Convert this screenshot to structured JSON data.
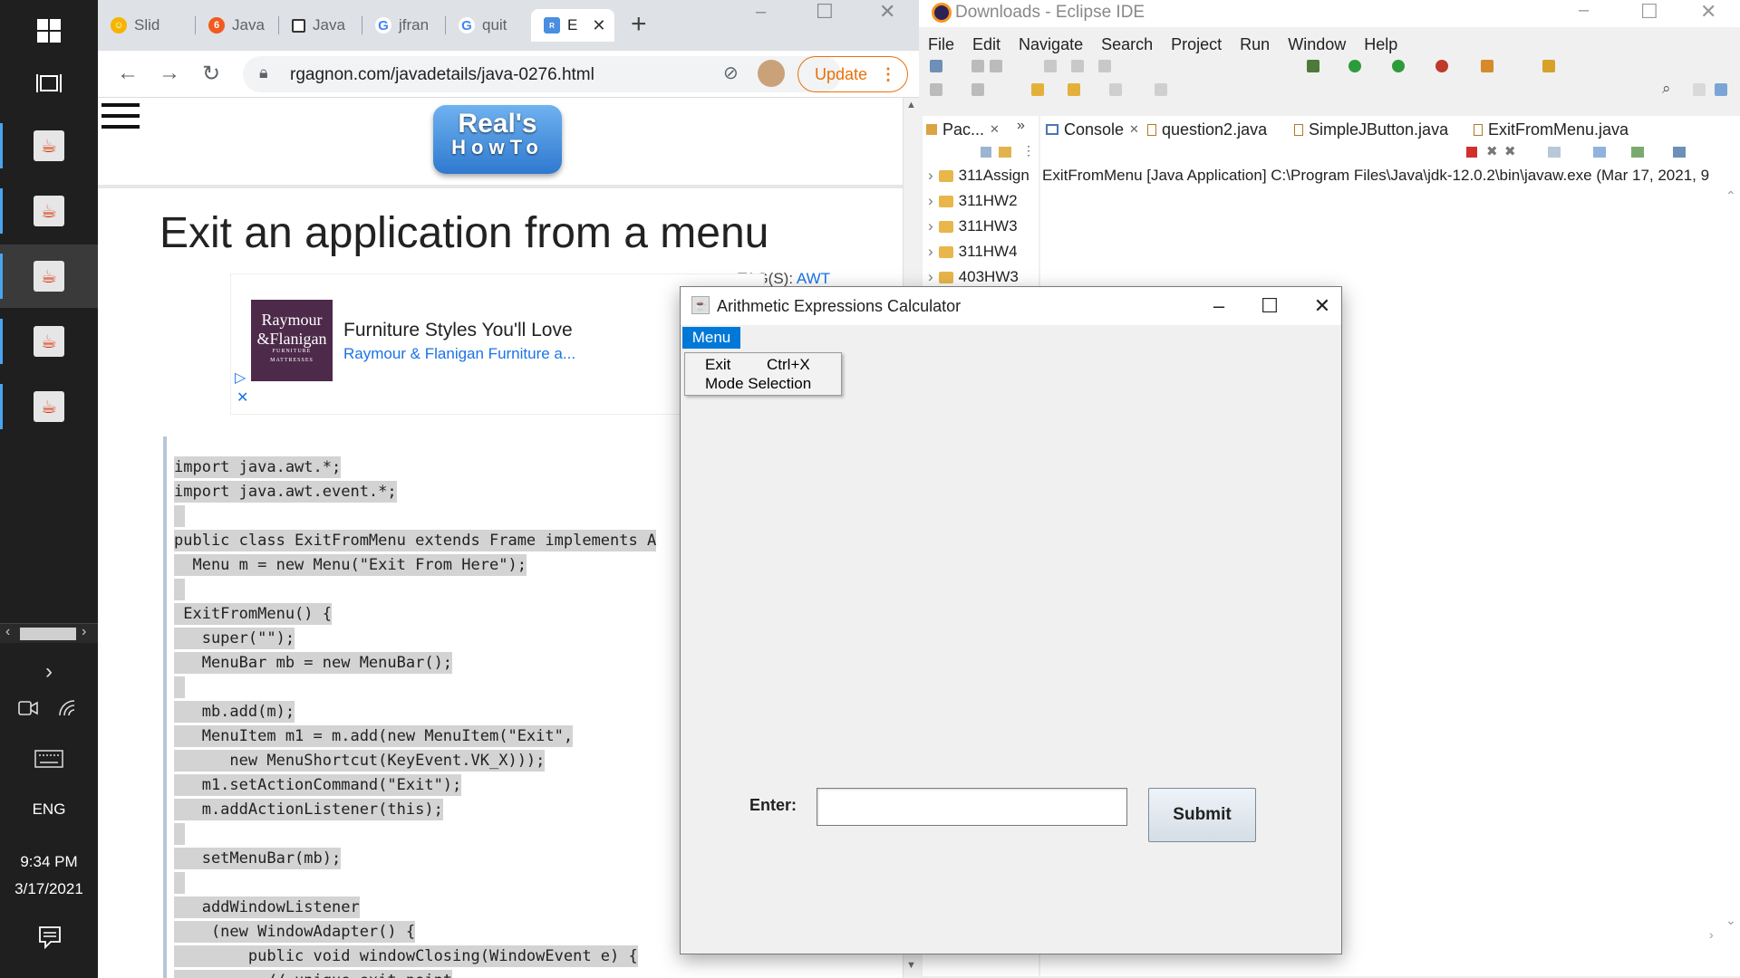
{
  "taskbar": {
    "language": "ENG",
    "time": "9:34 PM",
    "date": "3/17/2021"
  },
  "chrome": {
    "tabs": [
      {
        "label": "Slid",
        "icon": "slides-icon"
      },
      {
        "label": "Java",
        "icon": "orange-site-icon"
      },
      {
        "label": "Java",
        "icon": "square-site-icon"
      },
      {
        "label": "jfran",
        "icon": "google-icon"
      },
      {
        "label": "quit",
        "icon": "google-icon"
      },
      {
        "label": "E",
        "icon": "realshowto-icon",
        "active": true
      }
    ],
    "new_tab_label": "+",
    "url": "rgagnon.com/javadetails/java-0276.html",
    "update_label": "Update",
    "window_controls": [
      "–",
      "☐",
      "✕"
    ]
  },
  "page": {
    "logo_line1": "Real's",
    "logo_line2": "HowTo",
    "title": "Exit an application from a menu",
    "tags_label": "TAG(S):",
    "tags_value": "AWT",
    "ad": {
      "brand_line1": "Raymour",
      "brand_line2": "&Flanigan",
      "brand_line3": "FURNITURE",
      "brand_line4": "MATTRESSES",
      "headline": "Furniture Styles You'll Love",
      "subline": "Raymour & Flanigan Furniture a..."
    },
    "code_lines": [
      "import java.awt.*;",
      "import java.awt.event.*;",
      "",
      "public class ExitFromMenu extends Frame implements A",
      "  Menu m = new Menu(\"Exit From Here\");",
      "",
      " ExitFromMenu() {",
      "   super(\"\");",
      "   MenuBar mb = new MenuBar();",
      "",
      "   mb.add(m);",
      "   MenuItem m1 = m.add(new MenuItem(\"Exit\",",
      "      new MenuShortcut(KeyEvent.VK_X)));",
      "   m1.setActionCommand(\"Exit\");",
      "   m.addActionListener(this);",
      "",
      "   setMenuBar(mb);",
      "",
      "   addWindowListener",
      "    (new WindowAdapter() {",
      "        public void windowClosing(WindowEvent e) {",
      "          // unique exit point"
    ]
  },
  "eclipse": {
    "title": "Downloads - Eclipse IDE",
    "menus": [
      "File",
      "Edit",
      "Navigate",
      "Search",
      "Project",
      "Run",
      "Window",
      "Help"
    ],
    "package_tab": "Pac...",
    "overflow_tab": "»",
    "projects": [
      "311Assign",
      "311HW2",
      "311HW3",
      "311HW4",
      "403HW3"
    ],
    "editor_tabs": [
      {
        "label": "Console",
        "active": true
      },
      {
        "label": "question2.java"
      },
      {
        "label": "SimpleJButton.java"
      },
      {
        "label": "ExitFromMenu.java"
      }
    ],
    "console_line": "ExitFromMenu [Java Application] C:\\Program Files\\Java\\jdk-12.0.2\\bin\\javaw.exe  (Mar 17, 2021, 9"
  },
  "calculator": {
    "title": "Arithmetic Expressions Calculator",
    "menu_label": "Menu",
    "menu_items": [
      {
        "label": "Exit",
        "shortcut": "Ctrl+X"
      },
      {
        "label": "Mode Selection",
        "shortcut": ""
      }
    ],
    "enter_label": "Enter:",
    "input_value": "",
    "submit_label": "Submit"
  },
  "colors": {
    "taskbar_bg": "#1f1f1f",
    "chrome_tabstrip": "#dee1e6",
    "update_orange": "#e8710a",
    "menu_highlight": "#0078d7",
    "eclipse_bg": "#f0f0f0"
  }
}
